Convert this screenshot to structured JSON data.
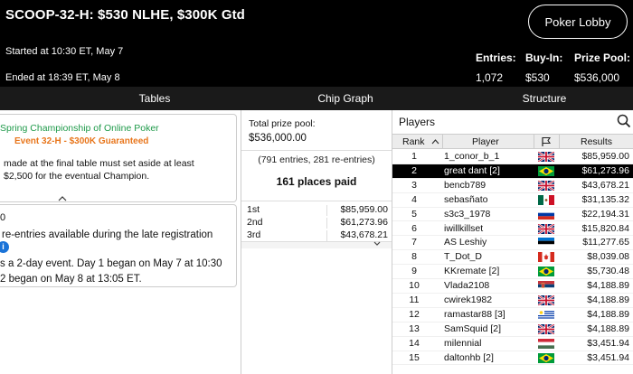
{
  "header": {
    "title": "SCOOP-32-H: $530 NLHE, $300K Gtd",
    "started": "Started at 10:30 ET, May 7",
    "ended": "Ended at 18:39 ET, May 8",
    "lobby_button": "Poker Lobby",
    "stats": [
      {
        "label": "Entries:",
        "value": "1,072"
      },
      {
        "label": "Buy-In:",
        "value": "$530"
      },
      {
        "label": "Prize Pool:",
        "value": "$536,000"
      }
    ]
  },
  "tabs": [
    "Tables",
    "Chip Graph",
    "Structure"
  ],
  "left": {
    "championship": "Spring Championship of Online Poker",
    "event": "Event 32-H - $300K Guaranteed",
    "final_line1": "made at the final table must set aside at least",
    "final_line2": "$2,500 for the eventual Champion.",
    "info_fragment": "0",
    "reentries": "re-entries available during the late registration",
    "day1": "s a 2-day event. Day 1 began on May 7 at 10:30",
    "day2": "2 began on May 8 at 13:05 ET."
  },
  "prize": {
    "label": "Total prize pool:",
    "value": "$536,000.00",
    "entries_line": "(791 entries, 281 re-entries)",
    "places": "161 places paid",
    "payouts": [
      {
        "place": "1st",
        "amount": "$85,959.00"
      },
      {
        "place": "2nd",
        "amount": "$61,273.96"
      },
      {
        "place": "3rd",
        "amount": "$43,678.21"
      }
    ]
  },
  "players": {
    "title": "Players",
    "headers": {
      "rank": "Rank",
      "player": "Player",
      "results": "Results"
    },
    "rows": [
      {
        "rank": "1",
        "name": "1_conor_b_1",
        "flag": "uk",
        "result": "$85,959.00",
        "selected": false
      },
      {
        "rank": "2",
        "name": "great dant [2]",
        "flag": "brazil",
        "result": "$61,273.96",
        "selected": true
      },
      {
        "rank": "3",
        "name": "bencb789",
        "flag": "uk",
        "result": "$43,678.21",
        "selected": false
      },
      {
        "rank": "4",
        "name": "sebasñato",
        "flag": "mexico",
        "result": "$31,135.32",
        "selected": false
      },
      {
        "rank": "5",
        "name": "s3c3_1978",
        "flag": "russia",
        "result": "$22,194.31",
        "selected": false
      },
      {
        "rank": "6",
        "name": "iwillkillset",
        "flag": "uk",
        "result": "$15,820.84",
        "selected": false
      },
      {
        "rank": "7",
        "name": "AS Leshiy",
        "flag": "estonia",
        "result": "$11,277.65",
        "selected": false
      },
      {
        "rank": "8",
        "name": "T_Dot_D",
        "flag": "canada",
        "result": "$8,039.08",
        "selected": false
      },
      {
        "rank": "9",
        "name": "KKremate [2]",
        "flag": "brazil",
        "result": "$5,730.48",
        "selected": false
      },
      {
        "rank": "10",
        "name": "Vlada2108",
        "flag": "serbia",
        "result": "$4,188.89",
        "selected": false
      },
      {
        "rank": "11",
        "name": "cwirek1982",
        "flag": "uk",
        "result": "$4,188.89",
        "selected": false
      },
      {
        "rank": "12",
        "name": "ramastar88 [3]",
        "flag": "uruguay",
        "result": "$4,188.89",
        "selected": false
      },
      {
        "rank": "13",
        "name": "SamSquid [2]",
        "flag": "uk",
        "result": "$4,188.89",
        "selected": false
      },
      {
        "rank": "14",
        "name": "milennial",
        "flag": "hungary",
        "result": "$3,451.94",
        "selected": false
      },
      {
        "rank": "15",
        "name": "daltonhb [2]",
        "flag": "brazil",
        "result": "$3,451.94",
        "selected": false
      }
    ]
  },
  "colors": {
    "green": "#1f9a4a",
    "orange": "#e8761c",
    "info_blue": "#1a73d8"
  }
}
